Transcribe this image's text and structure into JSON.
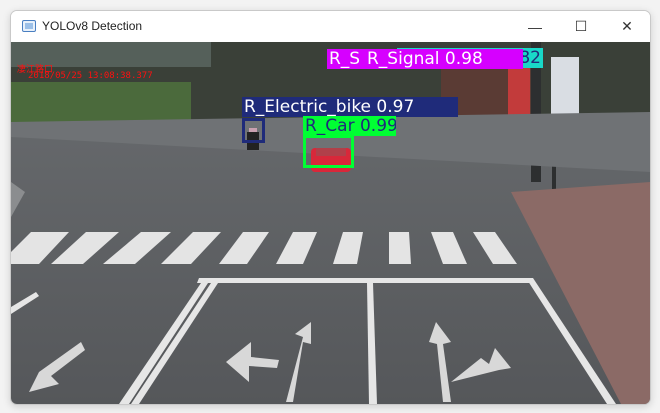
{
  "window": {
    "title": "YOLOv8 Detection",
    "minimize": "—",
    "maximize": "☐",
    "close": "✕"
  },
  "overlay": {
    "location": "凄江路口",
    "timestamp": "2018/05/25 13:08:38.377"
  },
  "detections": [
    {
      "label": "R_Electric_bike 0.97",
      "color": "#1f2b7a",
      "text_color": "#ffffff"
    },
    {
      "label": "R_Car 0.99",
      "color": "#00ff33",
      "text_color": "#1f2b7a"
    },
    {
      "label": "R_Signal 0.98",
      "color": "#d600ff",
      "text_color": "#ffffff"
    },
    {
      "label": "R_S",
      "color": "#d600ff",
      "text_color": "#ffffff"
    },
    {
      "label": "82",
      "color": "#19d8c8",
      "text_color": "#1f2b7a"
    }
  ]
}
